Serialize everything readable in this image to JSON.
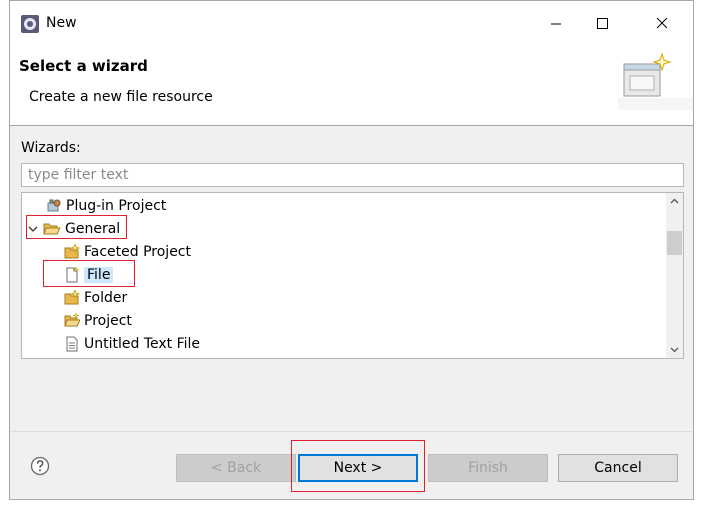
{
  "window": {
    "title": "New"
  },
  "banner": {
    "title": "Select a wizard",
    "description": "Create a new file resource"
  },
  "wizards": {
    "label": "Wizards:",
    "filter_placeholder": "type filter text",
    "items": [
      {
        "label": "Plug-in Project",
        "icon": "plugin-project-icon"
      },
      {
        "label": "General",
        "icon": "folder-open-icon",
        "expanded": true
      },
      {
        "label": "Faceted Project",
        "icon": "faceted-project-icon"
      },
      {
        "label": "File",
        "icon": "file-icon",
        "selected": true
      },
      {
        "label": "Folder",
        "icon": "folder-icon"
      },
      {
        "label": "Project",
        "icon": "project-icon"
      },
      {
        "label": "Untitled Text File",
        "icon": "text-file-icon"
      }
    ]
  },
  "buttons": {
    "back": "< Back",
    "next": "Next >",
    "finish": "Finish",
    "cancel": "Cancel"
  },
  "colors": {
    "selection": "#cce8ff",
    "focus_border": "#0078d7",
    "highlight": "#e0202e"
  }
}
